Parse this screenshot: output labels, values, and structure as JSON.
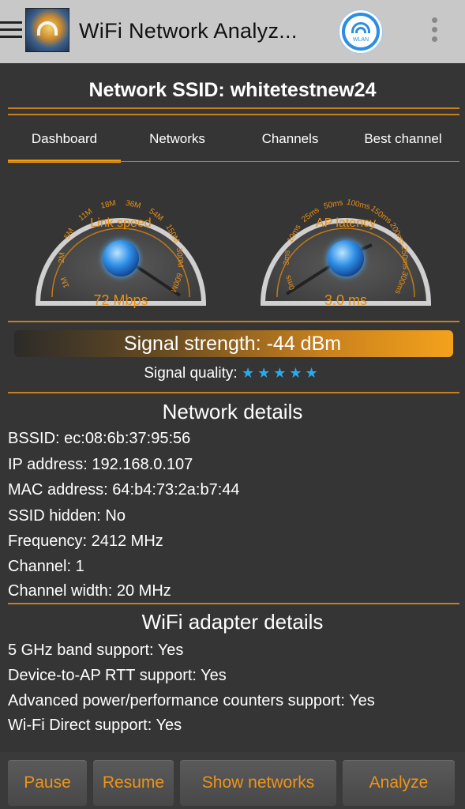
{
  "app": {
    "title": "WiFi Network Analyz...",
    "wifi_badge_text": "WLAN"
  },
  "ssid_line": "Network SSID: whitetestnew24",
  "tabs": [
    {
      "label": "Dashboard",
      "active": true
    },
    {
      "label": "Networks",
      "active": false
    },
    {
      "label": "Channels",
      "active": false
    },
    {
      "label": "Best channel",
      "active": false
    }
  ],
  "gauges": {
    "link_speed": {
      "label": "Link speed",
      "value_text": "72 Mbps",
      "ticks": [
        "1M",
        "2M",
        "5M",
        "11M",
        "18M",
        "36M",
        "54M",
        "150M",
        "300M",
        "600M"
      ]
    },
    "ap_latency": {
      "label": "AP latency",
      "value_text": "3.0 ms",
      "ticks": [
        "0ms",
        "3ms",
        "10ms",
        "25ms",
        "50ms",
        "100ms",
        "150ms",
        "200ms",
        "250ms",
        "300ms"
      ]
    }
  },
  "signal": {
    "strength_text": "Signal strength: -44 dBm",
    "quality_label": "Signal quality:",
    "quality_stars": "★★★★★",
    "quality_value": 5,
    "quality_max": 5
  },
  "network_details": {
    "title": "Network details",
    "lines": [
      "BSSID: ec:08:6b:37:95:56",
      "IP address: 192.168.0.107",
      "MAC address: 64:b4:73:2a:b7:44",
      "SSID hidden: No",
      "Frequency: 2412 MHz",
      "Channel: 1",
      "Channel width: 20 MHz"
    ]
  },
  "adapter_details": {
    "title": "WiFi adapter details",
    "lines": [
      "5 GHz band support: Yes",
      "Device-to-AP RTT support: Yes",
      "Advanced power/performance counters support: Yes",
      "Wi-Fi Direct support: Yes"
    ]
  },
  "buttons": {
    "pause": "Pause",
    "resume": "Resume",
    "show_networks": "Show networks",
    "analyze": "Analyze"
  },
  "colors": {
    "accent": "#f29b12",
    "gauge_text": "#e98f14",
    "star": "#29a9ee",
    "background": "#353535"
  }
}
